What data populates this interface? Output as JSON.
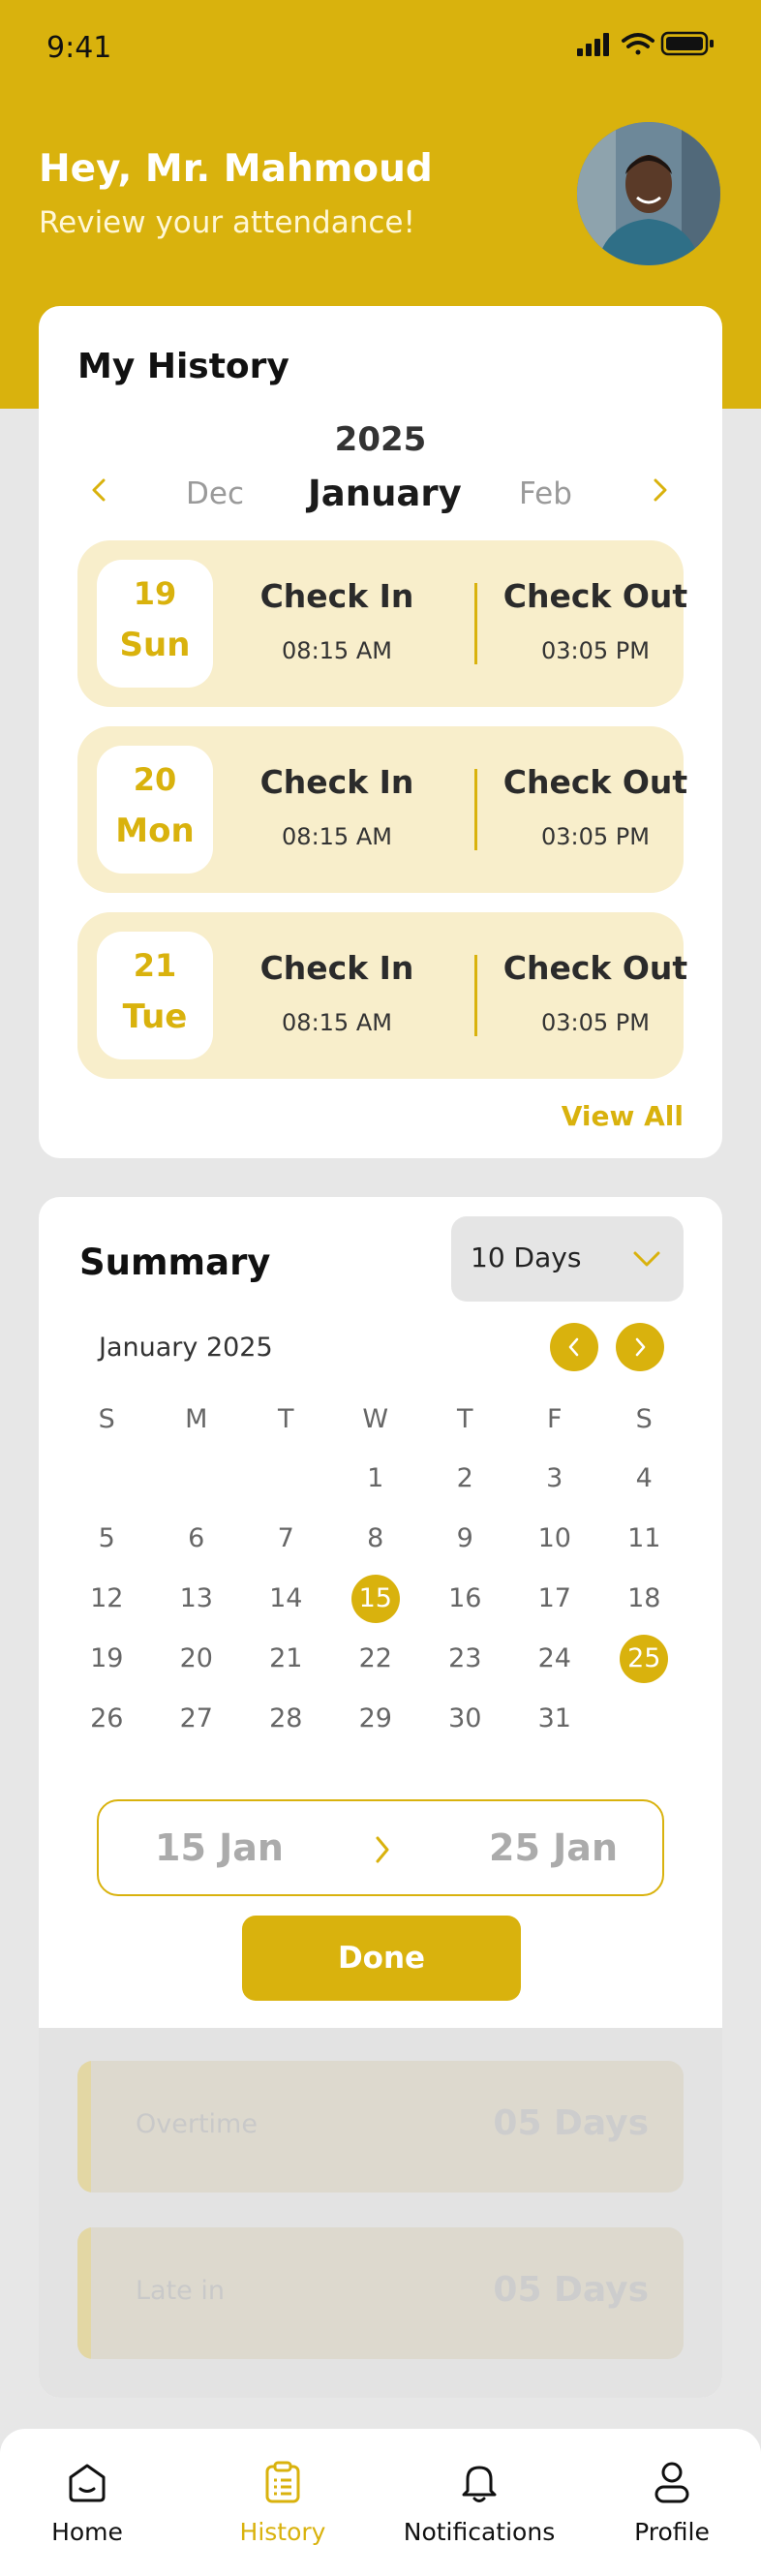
{
  "status_bar": {
    "time": "9:41"
  },
  "header": {
    "greeting": "Hey, Mr. Mahmoud",
    "subtitle": "Review your attendance!"
  },
  "history": {
    "title": "My History",
    "year": "2025",
    "prev_month": "Dec",
    "current_month": "January",
    "next_month": "Feb",
    "days": [
      {
        "num": "19",
        "name": "Sun",
        "check_in_label": "Check In",
        "check_in_time": "08:15 AM",
        "check_out_label": "Check Out",
        "check_out_time": "03:05 PM"
      },
      {
        "num": "20",
        "name": "Mon",
        "check_in_label": "Check In",
        "check_in_time": "08:15 AM",
        "check_out_label": "Check Out",
        "check_out_time": "03:05 PM"
      },
      {
        "num": "21",
        "name": "Tue",
        "check_in_label": "Check In",
        "check_in_time": "08:15 AM",
        "check_out_label": "Check Out",
        "check_out_time": "03:05 PM"
      }
    ],
    "view_all": "View  All"
  },
  "summary": {
    "title": "Summary",
    "range_select": "10 Days",
    "calendar": {
      "month_label": "January 2025",
      "weekdays": [
        "S",
        "M",
        "T",
        "W",
        "T",
        "F",
        "S"
      ],
      "weeks": [
        [
          "",
          "",
          "",
          "1",
          "2",
          "3",
          "4"
        ],
        [
          "5",
          "6",
          "7",
          "8",
          "9",
          "10",
          "11"
        ],
        [
          "12",
          "13",
          "14",
          "15",
          "16",
          "17",
          "18"
        ],
        [
          "19",
          "20",
          "21",
          "22",
          "23",
          "24",
          "25"
        ],
        [
          "26",
          "27",
          "28",
          "29",
          "30",
          "31",
          ""
        ]
      ],
      "selected": [
        "15",
        "25"
      ]
    },
    "range_start": "15 Jan",
    "range_end": "25 Jan",
    "done": "Done",
    "stats": [
      {
        "label": "Overtime",
        "value": "05 Days"
      },
      {
        "label": "Late in",
        "value": "05 Days"
      }
    ]
  },
  "tabs": [
    {
      "label": "Home",
      "icon": "home-icon",
      "active": false
    },
    {
      "label": "History",
      "icon": "clipboard-icon",
      "active": true
    },
    {
      "label": "Notifications",
      "icon": "bell-icon",
      "active": false
    },
    {
      "label": "Profile",
      "icon": "user-icon",
      "active": false
    }
  ],
  "colors": {
    "accent": "#d9b20d",
    "accent_light": "#f8eecb",
    "background": "#e7e7e7"
  }
}
